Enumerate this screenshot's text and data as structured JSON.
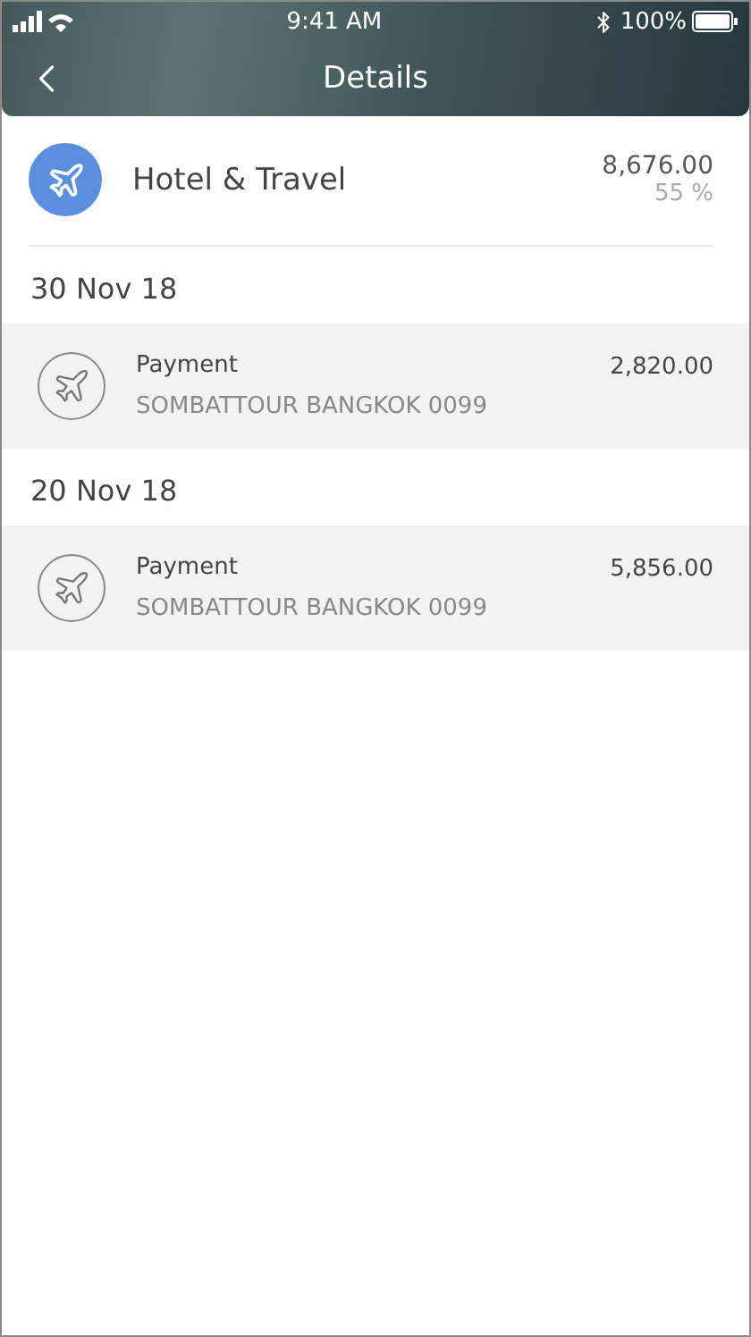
{
  "status_bar": {
    "time": "9:41 AM",
    "battery": "100%"
  },
  "header": {
    "title": "Details"
  },
  "category": {
    "name": "Hotel & Travel",
    "amount": "8,676.00",
    "share": "55 %"
  },
  "groups": [
    {
      "date": "30 Nov 18",
      "transactions": [
        {
          "type": "Payment",
          "merchant": "SOMBATTOUR BANGKOK 0099",
          "amount": "2,820.00"
        }
      ]
    },
    {
      "date": "20 Nov 18",
      "transactions": [
        {
          "type": "Payment",
          "merchant": "SOMBATTOUR BANGKOK 0099",
          "amount": "5,856.00"
        }
      ]
    }
  ]
}
